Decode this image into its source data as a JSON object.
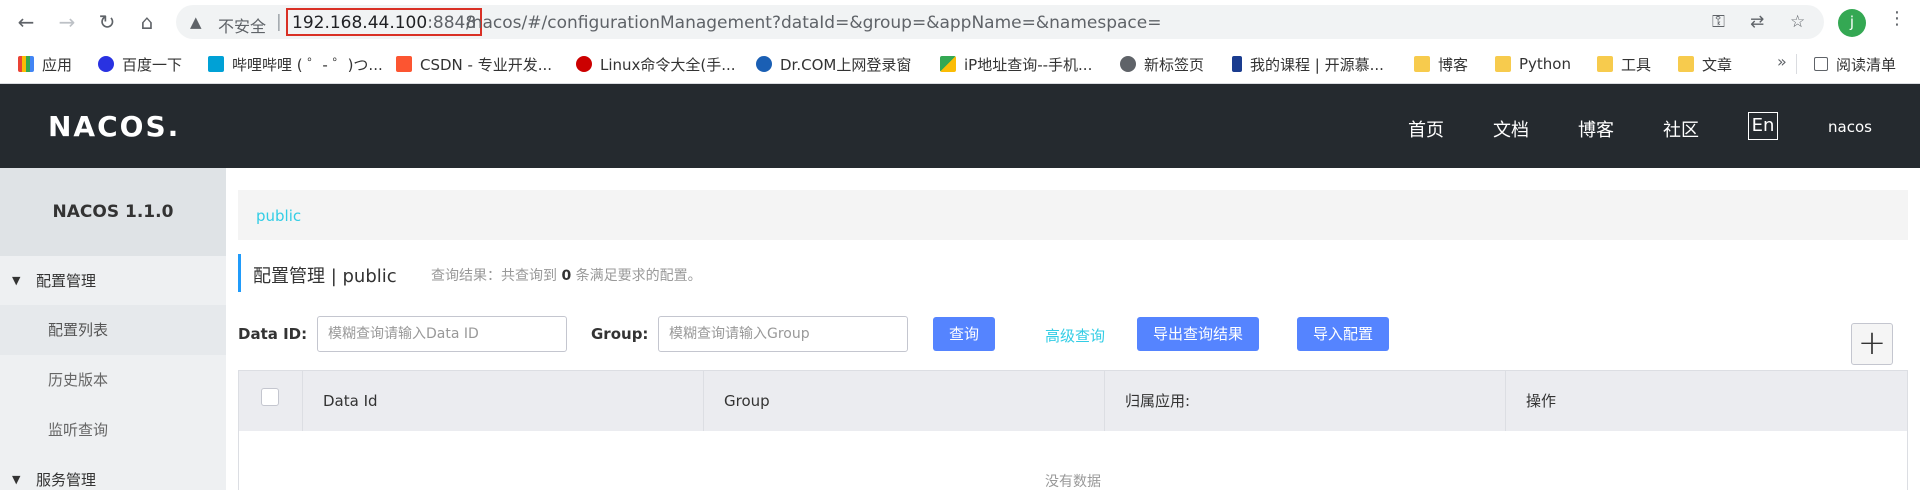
{
  "browser": {
    "insecure_label": "不安全",
    "url_host": "192.168.44.100",
    "url_port": ":8848",
    "url_path": "/nacos/#/configurationManagement?dataId=&group=&appName=&namespace=",
    "profile_initial": "j",
    "bookmarks": [
      {
        "label": "应用",
        "icon": "apps-grid-icon"
      },
      {
        "label": "百度一下",
        "icon": "baidu-paw-icon"
      },
      {
        "label": "哔哩哔哩 ( ゜- ゜)つ...",
        "icon": "bilibili-tv-icon"
      },
      {
        "label": "CSDN - 专业开发...",
        "icon": "csdn-icon"
      },
      {
        "label": "Linux命令大全(手...",
        "icon": "redhat-icon"
      },
      {
        "label": "Dr.COM上网登录窗",
        "icon": "drcom-icon"
      },
      {
        "label": "iP地址查询--手机...",
        "icon": "ip-query-icon"
      },
      {
        "label": "新标签页",
        "icon": "globe-icon"
      },
      {
        "label": "我的课程 | 开源慕...",
        "icon": "bookmark-flag-icon"
      },
      {
        "label": "博客",
        "icon": "folder-icon"
      },
      {
        "label": "Python",
        "icon": "folder-icon"
      },
      {
        "label": "工具",
        "icon": "folder-icon"
      },
      {
        "label": "文章",
        "icon": "folder-icon"
      }
    ],
    "more_label": "»",
    "reading_list": "阅读清单"
  },
  "header": {
    "logo": "NACOS.",
    "nav": [
      "首页",
      "文档",
      "博客",
      "社区"
    ],
    "lang": "En",
    "user": "nacos"
  },
  "sidebar": {
    "title": "NACOS 1.1.0",
    "config_group": "配置管理",
    "items": [
      "配置列表",
      "历史版本",
      "监听查询"
    ],
    "service_group": "服务管理"
  },
  "main": {
    "breadcrumb": "public",
    "title": "配置管理 | public",
    "result_prefix": "查询结果：共查询到 ",
    "result_count": "0",
    "result_suffix": " 条满足要求的配置。",
    "data_id_label": "Data ID:",
    "data_id_placeholder": "模糊查询请输入Data ID",
    "group_label": "Group:",
    "group_placeholder": "模糊查询请输入Group",
    "query_button": "查询",
    "advanced_query": "高级查询",
    "export_button": "导出查询结果",
    "import_button": "导入配置",
    "add_button": "+",
    "table": {
      "columns": [
        "Data Id",
        "Group",
        "归属应用:",
        "操作"
      ],
      "empty_text": "没有数据"
    }
  },
  "colors": {
    "topbar": "#252a2f",
    "primary_button": "#5584ff",
    "link": "#33cde5",
    "url_highlight_border": "#d93025"
  }
}
